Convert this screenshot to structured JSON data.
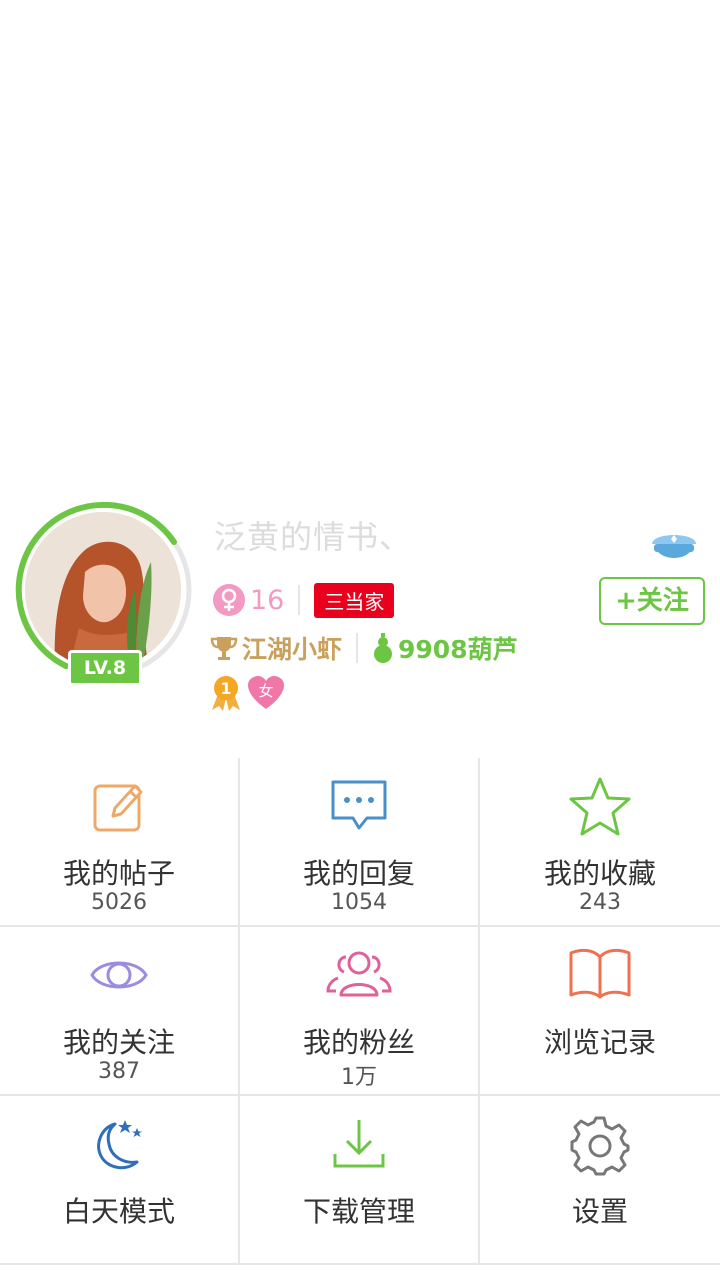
{
  "profile": {
    "username": "泛黄的情书、",
    "level": "LV.8",
    "age": "16",
    "title_badge": "三当家",
    "follow_label": "+关注",
    "rank": "江湖小虾",
    "gourds": "9908葫芦",
    "medal_number": "1",
    "heart_badge": "女",
    "colors": {
      "accent_green": "#6cc644",
      "pink": "#f29ac3",
      "badge_red": "#e8001c",
      "gold": "#c9a05c"
    }
  },
  "menu": [
    {
      "label": "我的帖子",
      "count": "5026",
      "icon": "edit-icon",
      "color": "#f0a868"
    },
    {
      "label": "我的回复",
      "count": "1054",
      "icon": "chat-bubble-icon",
      "color": "#4a90c8"
    },
    {
      "label": "我的收藏",
      "count": "243",
      "icon": "star-icon",
      "color": "#6cc644"
    },
    {
      "label": "我的关注",
      "count": "387",
      "icon": "eye-icon",
      "color": "#9b8ce0"
    },
    {
      "label": "我的粉丝",
      "count": "1万",
      "icon": "users-icon",
      "color": "#e0609a"
    },
    {
      "label": "浏览记录",
      "count": "",
      "icon": "book-icon",
      "color": "#f07050"
    },
    {
      "label": "白天模式",
      "count": "",
      "icon": "moon-stars-icon",
      "color": "#2f6fb8"
    },
    {
      "label": "下载管理",
      "count": "",
      "icon": "download-icon",
      "color": "#6cc644"
    },
    {
      "label": "设置",
      "count": "",
      "icon": "gear-icon",
      "color": "#777777"
    }
  ]
}
